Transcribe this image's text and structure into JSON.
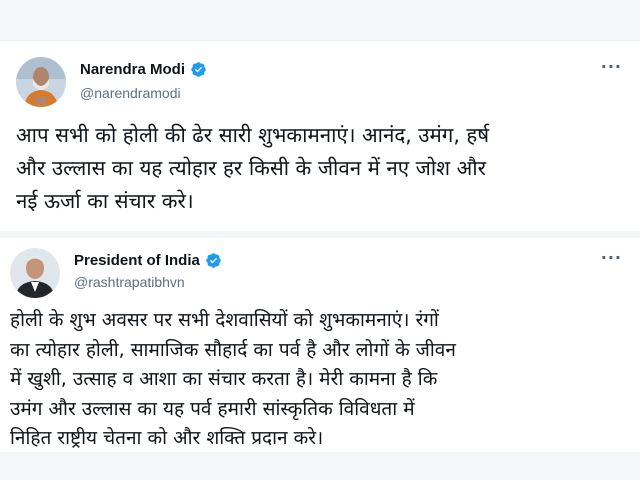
{
  "colors": {
    "verified": "#1d9bf0",
    "text": "#0f1419",
    "muted": "#5b7083"
  },
  "tweets": [
    {
      "author": "Narendra Modi",
      "handle": "@narendramodi",
      "verified_icon": "verified-badge-icon",
      "more_icon": "ellipsis-icon",
      "more_glyph": "···",
      "text": "आप सभी को होली की ढेर सारी शुभकामनाएं। आनंद, उमंग, हर्ष\nऔर उल्लास का यह त्योहार हर किसी के जीवन में नए जोश और\nनई ऊर्जा का संचार करे।"
    },
    {
      "author": "President of India",
      "handle": "@rashtrapatibhvn",
      "verified_icon": "verified-badge-icon",
      "more_icon": "ellipsis-icon",
      "more_glyph": "···",
      "text": "होली के शुभ अवसर पर सभी देशवासियों को शुभकामनाएं। रंगों\nका त्योहार होली, सामाजिक सौहार्द का पर्व है और लोगों के जीवन\nमें खुशी, उत्साह व आशा का संचार करता है। मेरी कामना है कि\nउमंग और उल्लास का यह पर्व हमारी सांस्कृतिक विविधता में\nनिहित राष्ट्रीय चेतना को और शक्ति प्रदान करे।"
    }
  ]
}
